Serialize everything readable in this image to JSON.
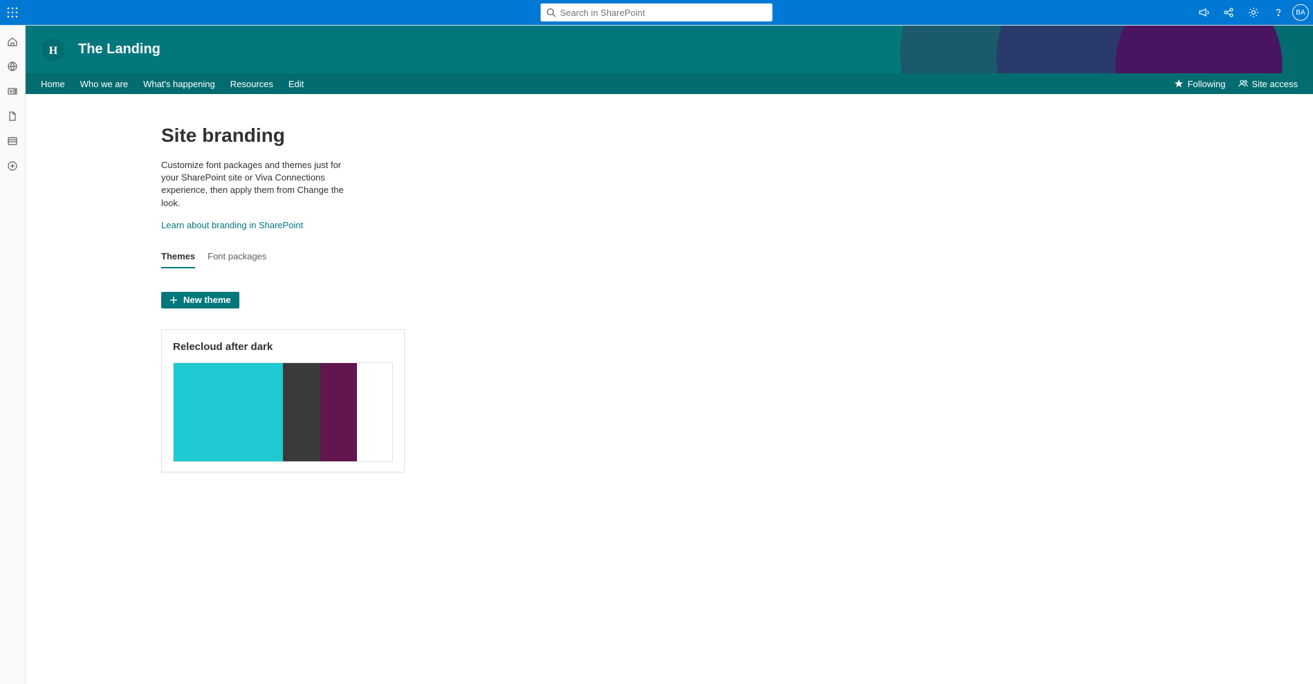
{
  "top": {
    "search_placeholder": "Search in SharePoint",
    "avatar_initials": "BA"
  },
  "site": {
    "logo_letter": "H",
    "title": "The Landing",
    "nav": [
      "Home",
      "Who we are",
      "What's happening",
      "Resources",
      "Edit"
    ],
    "following_label": "Following",
    "site_access_label": "Site access"
  },
  "page": {
    "title": "Site branding",
    "description": "Customize font packages and themes just for your SharePoint site or Viva Connections experience, then apply them from Change the look.",
    "learn_link": "Learn about branding in SharePoint",
    "tabs": {
      "themes": "Themes",
      "font_packages": "Font packages"
    },
    "new_theme_label": "New theme"
  },
  "theme_card": {
    "name": "Relecloud after dark",
    "colors": [
      "#1fc9d1",
      "#3a3a3a",
      "#63164d",
      "#ffffff"
    ]
  },
  "colors": {
    "brand_blue": "#0078d4",
    "brand_teal": "#03787c"
  }
}
